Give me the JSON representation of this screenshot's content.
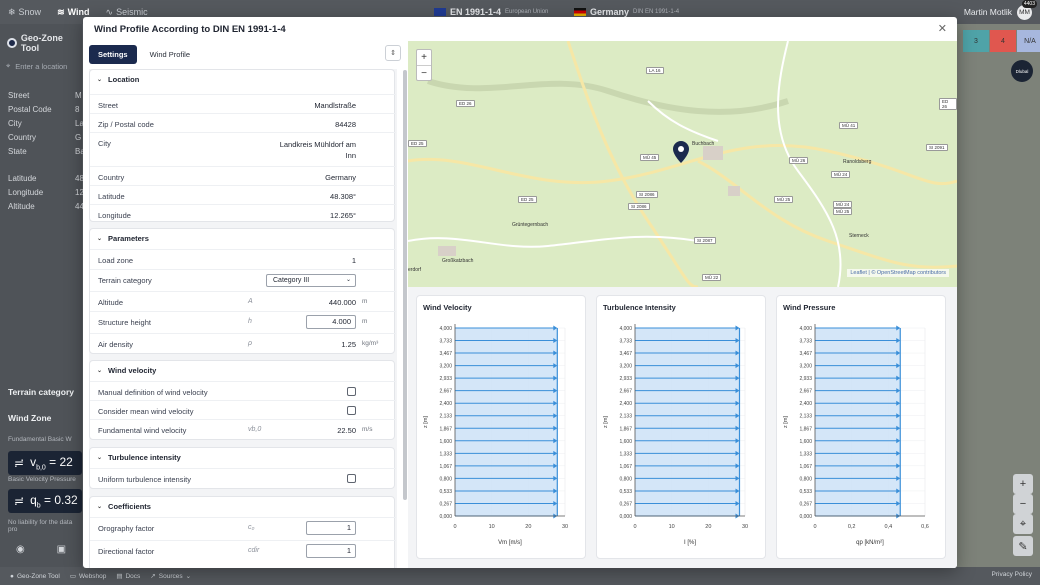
{
  "topbar": {
    "tabs": [
      {
        "label": "Snow",
        "icon": "snowflake-icon"
      },
      {
        "label": "Wind",
        "icon": "wind-icon"
      },
      {
        "label": "Seismic",
        "icon": "seismic-icon"
      }
    ],
    "standard_eu": {
      "label": "EN 1991-1-4",
      "sub": "European Union"
    },
    "standard_de": {
      "label": "Germany",
      "sub": "DIN EN 1991-1-4"
    },
    "user": "Martin Motlik",
    "avatar": "MM",
    "notifications": "4403"
  },
  "left_panel": {
    "app_name": "Geo-Zone Tool",
    "search_placeholder": "Enter a location",
    "rows": [
      {
        "label": "Street",
        "value": "M"
      },
      {
        "label": "Postal Code",
        "value": "8"
      },
      {
        "label": "City",
        "value": "La"
      },
      {
        "label": "Country",
        "value": "G"
      },
      {
        "label": "State",
        "value": "Ba"
      },
      {
        "label": "Latitude",
        "value": "48"
      },
      {
        "label": "Longitude",
        "value": "12"
      },
      {
        "label": "Altitude",
        "value": "44"
      }
    ],
    "terrain_category": "Terrain category",
    "wind_zone": "Wind Zone",
    "fund_label": "Fundamental Basic W",
    "vb_badge": "v",
    "vb_sub": "b,0",
    "vb_value": "= 22",
    "bvp_label": "Basic Velocity Pressure",
    "qb_badge": "q",
    "qb_sub": "b",
    "qb_value": "= 0.32",
    "liability": "No liability for the data pro"
  },
  "footer": {
    "items": [
      "Geo-Zone Tool",
      "Webshop",
      "Docs",
      "Sources"
    ],
    "privacy": "Privacy Policy"
  },
  "right_bg": {
    "zones": [
      {
        "label": "3",
        "color": "#4fa3a8"
      },
      {
        "label": "4",
        "color": "#e0574f"
      },
      {
        "label": "N/A",
        "color": "#a7b7de"
      }
    ],
    "logo_text": "Dlubal"
  },
  "modal": {
    "title": "Wind Profile According to DIN EN 1991-1-4",
    "tabs": [
      "Settings",
      "Wind Profile"
    ],
    "sections": {
      "location": {
        "title": "Location",
        "rows": [
          {
            "label": "Street",
            "value": "Mandlstraße"
          },
          {
            "label": "Zip / Postal code",
            "value": "84428"
          },
          {
            "label": "City",
            "value": "Landkreis Mühldorf am",
            "value2": "Inn"
          },
          {
            "label": "Country",
            "value": "Germany"
          },
          {
            "label": "Latitude",
            "value": "48.308°"
          },
          {
            "label": "Longitude",
            "value": "12.265°"
          }
        ]
      },
      "parameters": {
        "title": "Parameters",
        "load_zone": {
          "label": "Load zone",
          "value": "1"
        },
        "terrain": {
          "label": "Terrain category",
          "value": "Category III"
        },
        "altitude": {
          "label": "Altitude",
          "sym": "A",
          "value": "440.000",
          "unit": "m"
        },
        "height": {
          "label": "Structure height",
          "sym": "h",
          "value": "4.000",
          "unit": "m"
        },
        "density": {
          "label": "Air density",
          "sym": "ρ",
          "value": "1.25",
          "unit": "kg/m³"
        }
      },
      "wind_velocity": {
        "title": "Wind velocity",
        "manual": "Manual definition of wind velocity",
        "mean": "Consider mean wind velocity",
        "fund": {
          "label": "Fundamental wind velocity",
          "sym": "vb,0",
          "value": "22.50",
          "unit": "m/s"
        }
      },
      "turbulence": {
        "title": "Turbulence intensity",
        "uniform": "Uniform turbulence intensity"
      },
      "coefficients": {
        "title": "Coefficients",
        "orography": {
          "label": "Orography factor",
          "sym": "c₀",
          "value": "1"
        },
        "directional": {
          "label": "Directional factor",
          "sym": "cdir",
          "value": "1"
        }
      }
    }
  },
  "map": {
    "places": [
      {
        "name": "Buchbach"
      },
      {
        "name": "Ranoldsberg"
      },
      {
        "name": "Grüntegernbach"
      },
      {
        "name": "Großkatzbach"
      },
      {
        "name": "Sterneck"
      },
      {
        "name": "erdorf"
      }
    ],
    "roads": [
      "LA 16",
      "ED 26",
      "MÜ 41",
      "MÜ 45",
      "SI 2086",
      "ED 25",
      "MÜ 24",
      "SI 2087",
      "MÜ 22",
      "MÜ 25",
      "MÜ 26",
      "ED 26",
      "MÜ 24",
      "MÜ 25",
      "ED 25",
      "SI 2086",
      "SI 2091"
    ],
    "attribution": "Leaflet | © OpenStreetMap contributors",
    "zoom_in": "+",
    "zoom_out": "−"
  },
  "chart_data": [
    {
      "type": "bar",
      "orientation": "horizontal",
      "title": "Wind Velocity",
      "xlabel": "Vm [m/s]",
      "ylabel": "z [m]",
      "y": [
        4.0,
        3.733,
        3.467,
        3.2,
        2.933,
        2.667,
        2.4,
        2.133,
        1.867,
        1.6,
        1.333,
        1.067,
        0.8,
        0.533,
        0.267,
        0.0
      ],
      "y_tick_labels": [
        "4,000",
        "3,733",
        "3,467",
        "3,200",
        "2,933",
        "2,667",
        "2,400",
        "2,133",
        "1,867",
        "1,600",
        "1,333",
        "1,067",
        "0,800",
        "0,533",
        "0,267",
        "0,000"
      ],
      "values": [
        27.9,
        27.9,
        27.9,
        27.9,
        27.9,
        27.9,
        27.9,
        27.9,
        27.9,
        27.9,
        27.9,
        27.9,
        27.9,
        27.9,
        27.9,
        27.9
      ],
      "xlim": [
        0,
        30
      ],
      "x_ticks": [
        "0",
        "10",
        "20",
        "30"
      ],
      "grid": true,
      "color": "#3a8fd9"
    },
    {
      "type": "bar",
      "orientation": "horizontal",
      "title": "Turbulence Intensity",
      "xlabel": "I [%]",
      "ylabel": "z [m]",
      "y": [
        4.0,
        3.733,
        3.467,
        3.2,
        2.933,
        2.667,
        2.4,
        2.133,
        1.867,
        1.6,
        1.333,
        1.067,
        0.8,
        0.533,
        0.267,
        0.0
      ],
      "y_tick_labels": [
        "4,000",
        "3,733",
        "3,467",
        "3,200",
        "2,933",
        "2,667",
        "2,400",
        "2,133",
        "1,867",
        "1,600",
        "1,333",
        "1,067",
        "0,800",
        "0,533",
        "0,267",
        "0,000"
      ],
      "values": [
        28.5,
        28.5,
        28.5,
        28.5,
        28.5,
        28.5,
        28.5,
        28.5,
        28.5,
        28.5,
        28.5,
        28.5,
        28.5,
        28.5,
        28.5,
        28.5
      ],
      "xlim": [
        0,
        30
      ],
      "x_ticks": [
        "0",
        "10",
        "20",
        "30"
      ],
      "grid": true,
      "color": "#3a8fd9"
    },
    {
      "type": "bar",
      "orientation": "horizontal",
      "title": "Wind Pressure",
      "xlabel": "qp [kN/m²]",
      "ylabel": "z [m]",
      "y": [
        4.0,
        3.733,
        3.467,
        3.2,
        2.933,
        2.667,
        2.4,
        2.133,
        1.867,
        1.6,
        1.333,
        1.067,
        0.8,
        0.533,
        0.267,
        0.0
      ],
      "y_tick_labels": [
        "4,000",
        "3,733",
        "3,467",
        "3,200",
        "2,933",
        "2,667",
        "2,400",
        "2,133",
        "1,867",
        "1,600",
        "1,333",
        "1,067",
        "0,800",
        "0,533",
        "0,267",
        "0,000"
      ],
      "values": [
        0.465,
        0.465,
        0.465,
        0.465,
        0.465,
        0.465,
        0.465,
        0.465,
        0.465,
        0.465,
        0.465,
        0.465,
        0.465,
        0.465,
        0.465,
        0.465
      ],
      "xlim": [
        0,
        0.6
      ],
      "x_ticks": [
        "0",
        "0,2",
        "0,4",
        "0,6"
      ],
      "grid": true,
      "color": "#3a8fd9"
    }
  ]
}
